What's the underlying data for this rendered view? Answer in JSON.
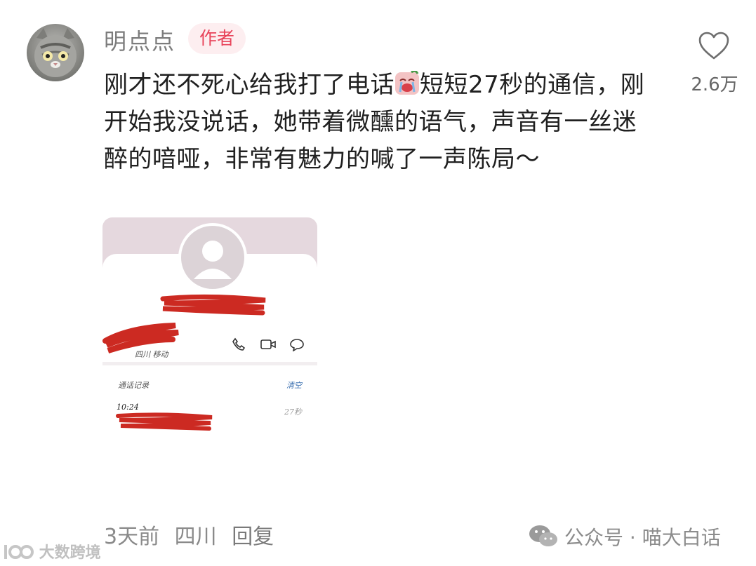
{
  "comment": {
    "username": "明点点",
    "badge": "作者",
    "text_part1": "刚才还不死心给我打了电话",
    "emoji": "crying-face-emoji",
    "text_part2": "短短27秒的通信，刚开始我没说话，她带着微醺的语气，声音有一丝迷醉的喑哑，非常有魅力的喊了一声陈局～",
    "likes": "2.6万",
    "time": "3天前",
    "location": "四川",
    "reply_label": "回复"
  },
  "attachment": {
    "call_log_title": "通话记录",
    "clear_label": "清空",
    "call_time": "10:24",
    "call_duration": "27秒",
    "contact_subtext": "四川 移动"
  },
  "watermarks": {
    "left": "大数跨境",
    "right": "公众号 · 喵大白话"
  },
  "colors": {
    "badge_text": "#e8435a",
    "badge_bg": "#fdeef0",
    "redaction": "#cc2a22"
  }
}
